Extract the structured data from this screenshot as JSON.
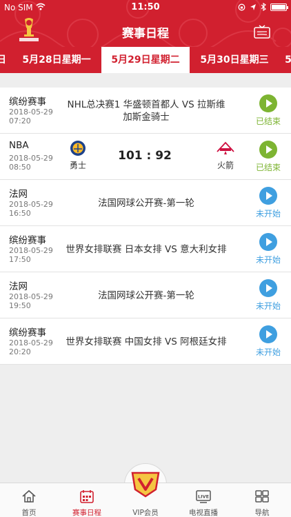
{
  "status_bar": {
    "carrier": "No SIM",
    "time": "11:50"
  },
  "header": {
    "title": "赛事日程",
    "logo": "world-cup-logo",
    "right_icon": "tv-schedule-icon"
  },
  "colors": {
    "brand_red": "#d1202f",
    "finished_green": "#7db432",
    "upcoming_blue": "#3f9fe0"
  },
  "date_tabs": [
    {
      "label": "日"
    },
    {
      "label": "5月28日星期一"
    },
    {
      "label": "5月29日星期二"
    },
    {
      "label": "5月30日星期三"
    },
    {
      "label": "5"
    }
  ],
  "selected_date_index": 2,
  "events": [
    {
      "category": "缤纷赛事",
      "date": "2018-05-29",
      "time": "07:20",
      "title": "NHL总决赛1 华盛顿首都人 VS 拉斯维加斯金骑士",
      "status": "已结束",
      "state": "done"
    },
    {
      "category": "NBA",
      "date": "2018-05-29",
      "time": "08:50",
      "home_team": "勇士",
      "away_team": "火箭",
      "score": "101 : 92",
      "status": "已结束",
      "state": "done"
    },
    {
      "category": "法网",
      "date": "2018-05-29",
      "time": "16:50",
      "title": "法国网球公开赛-第一轮",
      "status": "未开始",
      "state": "todo"
    },
    {
      "category": "缤纷赛事",
      "date": "2018-05-29",
      "time": "17:50",
      "title": "世界女排联赛 日本女排 VS 意大利女排",
      "status": "未开始",
      "state": "todo"
    },
    {
      "category": "法网",
      "date": "2018-05-29",
      "time": "19:50",
      "title": "法国网球公开赛-第一轮",
      "status": "未开始",
      "state": "todo"
    },
    {
      "category": "缤纷赛事",
      "date": "2018-05-29",
      "time": "20:20",
      "title": "世界女排联赛 中国女排 VS 阿根廷女排",
      "status": "未开始",
      "state": "todo"
    }
  ],
  "tabbar": [
    {
      "label": "首页",
      "icon": "home-icon"
    },
    {
      "label": "赛事日程",
      "icon": "calendar-icon"
    },
    {
      "label": "VIP会员",
      "icon": "vip-badge-icon"
    },
    {
      "label": "电视直播",
      "icon": "live-tv-icon"
    },
    {
      "label": "导航",
      "icon": "grid-nav-icon"
    }
  ]
}
